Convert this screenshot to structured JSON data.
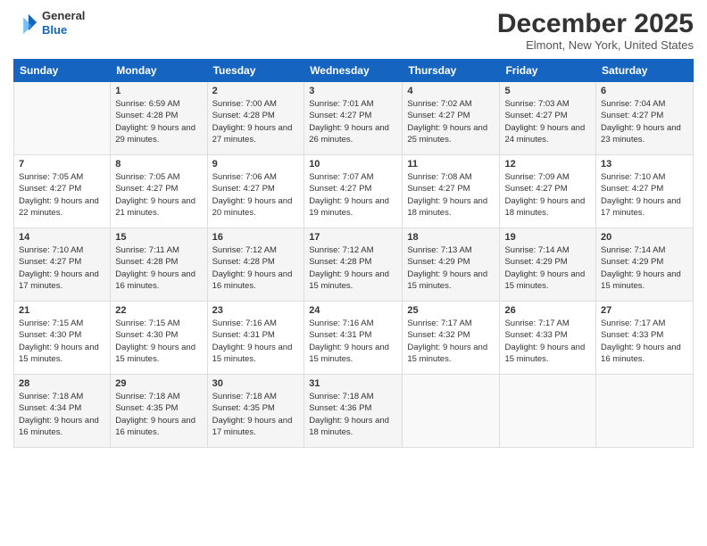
{
  "logo": {
    "line1": "General",
    "line2": "Blue"
  },
  "header": {
    "title": "December 2025",
    "location": "Elmont, New York, United States"
  },
  "days_of_week": [
    "Sunday",
    "Monday",
    "Tuesday",
    "Wednesday",
    "Thursday",
    "Friday",
    "Saturday"
  ],
  "weeks": [
    [
      {
        "num": "",
        "sunrise": "",
        "sunset": "",
        "daylight": ""
      },
      {
        "num": "1",
        "sunrise": "Sunrise: 6:59 AM",
        "sunset": "Sunset: 4:28 PM",
        "daylight": "Daylight: 9 hours and 29 minutes."
      },
      {
        "num": "2",
        "sunrise": "Sunrise: 7:00 AM",
        "sunset": "Sunset: 4:28 PM",
        "daylight": "Daylight: 9 hours and 27 minutes."
      },
      {
        "num": "3",
        "sunrise": "Sunrise: 7:01 AM",
        "sunset": "Sunset: 4:27 PM",
        "daylight": "Daylight: 9 hours and 26 minutes."
      },
      {
        "num": "4",
        "sunrise": "Sunrise: 7:02 AM",
        "sunset": "Sunset: 4:27 PM",
        "daylight": "Daylight: 9 hours and 25 minutes."
      },
      {
        "num": "5",
        "sunrise": "Sunrise: 7:03 AM",
        "sunset": "Sunset: 4:27 PM",
        "daylight": "Daylight: 9 hours and 24 minutes."
      },
      {
        "num": "6",
        "sunrise": "Sunrise: 7:04 AM",
        "sunset": "Sunset: 4:27 PM",
        "daylight": "Daylight: 9 hours and 23 minutes."
      }
    ],
    [
      {
        "num": "7",
        "sunrise": "Sunrise: 7:05 AM",
        "sunset": "Sunset: 4:27 PM",
        "daylight": "Daylight: 9 hours and 22 minutes."
      },
      {
        "num": "8",
        "sunrise": "Sunrise: 7:05 AM",
        "sunset": "Sunset: 4:27 PM",
        "daylight": "Daylight: 9 hours and 21 minutes."
      },
      {
        "num": "9",
        "sunrise": "Sunrise: 7:06 AM",
        "sunset": "Sunset: 4:27 PM",
        "daylight": "Daylight: 9 hours and 20 minutes."
      },
      {
        "num": "10",
        "sunrise": "Sunrise: 7:07 AM",
        "sunset": "Sunset: 4:27 PM",
        "daylight": "Daylight: 9 hours and 19 minutes."
      },
      {
        "num": "11",
        "sunrise": "Sunrise: 7:08 AM",
        "sunset": "Sunset: 4:27 PM",
        "daylight": "Daylight: 9 hours and 18 minutes."
      },
      {
        "num": "12",
        "sunrise": "Sunrise: 7:09 AM",
        "sunset": "Sunset: 4:27 PM",
        "daylight": "Daylight: 9 hours and 18 minutes."
      },
      {
        "num": "13",
        "sunrise": "Sunrise: 7:10 AM",
        "sunset": "Sunset: 4:27 PM",
        "daylight": "Daylight: 9 hours and 17 minutes."
      }
    ],
    [
      {
        "num": "14",
        "sunrise": "Sunrise: 7:10 AM",
        "sunset": "Sunset: 4:27 PM",
        "daylight": "Daylight: 9 hours and 17 minutes."
      },
      {
        "num": "15",
        "sunrise": "Sunrise: 7:11 AM",
        "sunset": "Sunset: 4:28 PM",
        "daylight": "Daylight: 9 hours and 16 minutes."
      },
      {
        "num": "16",
        "sunrise": "Sunrise: 7:12 AM",
        "sunset": "Sunset: 4:28 PM",
        "daylight": "Daylight: 9 hours and 16 minutes."
      },
      {
        "num": "17",
        "sunrise": "Sunrise: 7:12 AM",
        "sunset": "Sunset: 4:28 PM",
        "daylight": "Daylight: 9 hours and 15 minutes."
      },
      {
        "num": "18",
        "sunrise": "Sunrise: 7:13 AM",
        "sunset": "Sunset: 4:29 PM",
        "daylight": "Daylight: 9 hours and 15 minutes."
      },
      {
        "num": "19",
        "sunrise": "Sunrise: 7:14 AM",
        "sunset": "Sunset: 4:29 PM",
        "daylight": "Daylight: 9 hours and 15 minutes."
      },
      {
        "num": "20",
        "sunrise": "Sunrise: 7:14 AM",
        "sunset": "Sunset: 4:29 PM",
        "daylight": "Daylight: 9 hours and 15 minutes."
      }
    ],
    [
      {
        "num": "21",
        "sunrise": "Sunrise: 7:15 AM",
        "sunset": "Sunset: 4:30 PM",
        "daylight": "Daylight: 9 hours and 15 minutes."
      },
      {
        "num": "22",
        "sunrise": "Sunrise: 7:15 AM",
        "sunset": "Sunset: 4:30 PM",
        "daylight": "Daylight: 9 hours and 15 minutes."
      },
      {
        "num": "23",
        "sunrise": "Sunrise: 7:16 AM",
        "sunset": "Sunset: 4:31 PM",
        "daylight": "Daylight: 9 hours and 15 minutes."
      },
      {
        "num": "24",
        "sunrise": "Sunrise: 7:16 AM",
        "sunset": "Sunset: 4:31 PM",
        "daylight": "Daylight: 9 hours and 15 minutes."
      },
      {
        "num": "25",
        "sunrise": "Sunrise: 7:17 AM",
        "sunset": "Sunset: 4:32 PM",
        "daylight": "Daylight: 9 hours and 15 minutes."
      },
      {
        "num": "26",
        "sunrise": "Sunrise: 7:17 AM",
        "sunset": "Sunset: 4:33 PM",
        "daylight": "Daylight: 9 hours and 15 minutes."
      },
      {
        "num": "27",
        "sunrise": "Sunrise: 7:17 AM",
        "sunset": "Sunset: 4:33 PM",
        "daylight": "Daylight: 9 hours and 16 minutes."
      }
    ],
    [
      {
        "num": "28",
        "sunrise": "Sunrise: 7:18 AM",
        "sunset": "Sunset: 4:34 PM",
        "daylight": "Daylight: 9 hours and 16 minutes."
      },
      {
        "num": "29",
        "sunrise": "Sunrise: 7:18 AM",
        "sunset": "Sunset: 4:35 PM",
        "daylight": "Daylight: 9 hours and 16 minutes."
      },
      {
        "num": "30",
        "sunrise": "Sunrise: 7:18 AM",
        "sunset": "Sunset: 4:35 PM",
        "daylight": "Daylight: 9 hours and 17 minutes."
      },
      {
        "num": "31",
        "sunrise": "Sunrise: 7:18 AM",
        "sunset": "Sunset: 4:36 PM",
        "daylight": "Daylight: 9 hours and 18 minutes."
      },
      {
        "num": "",
        "sunrise": "",
        "sunset": "",
        "daylight": ""
      },
      {
        "num": "",
        "sunrise": "",
        "sunset": "",
        "daylight": ""
      },
      {
        "num": "",
        "sunrise": "",
        "sunset": "",
        "daylight": ""
      }
    ]
  ]
}
